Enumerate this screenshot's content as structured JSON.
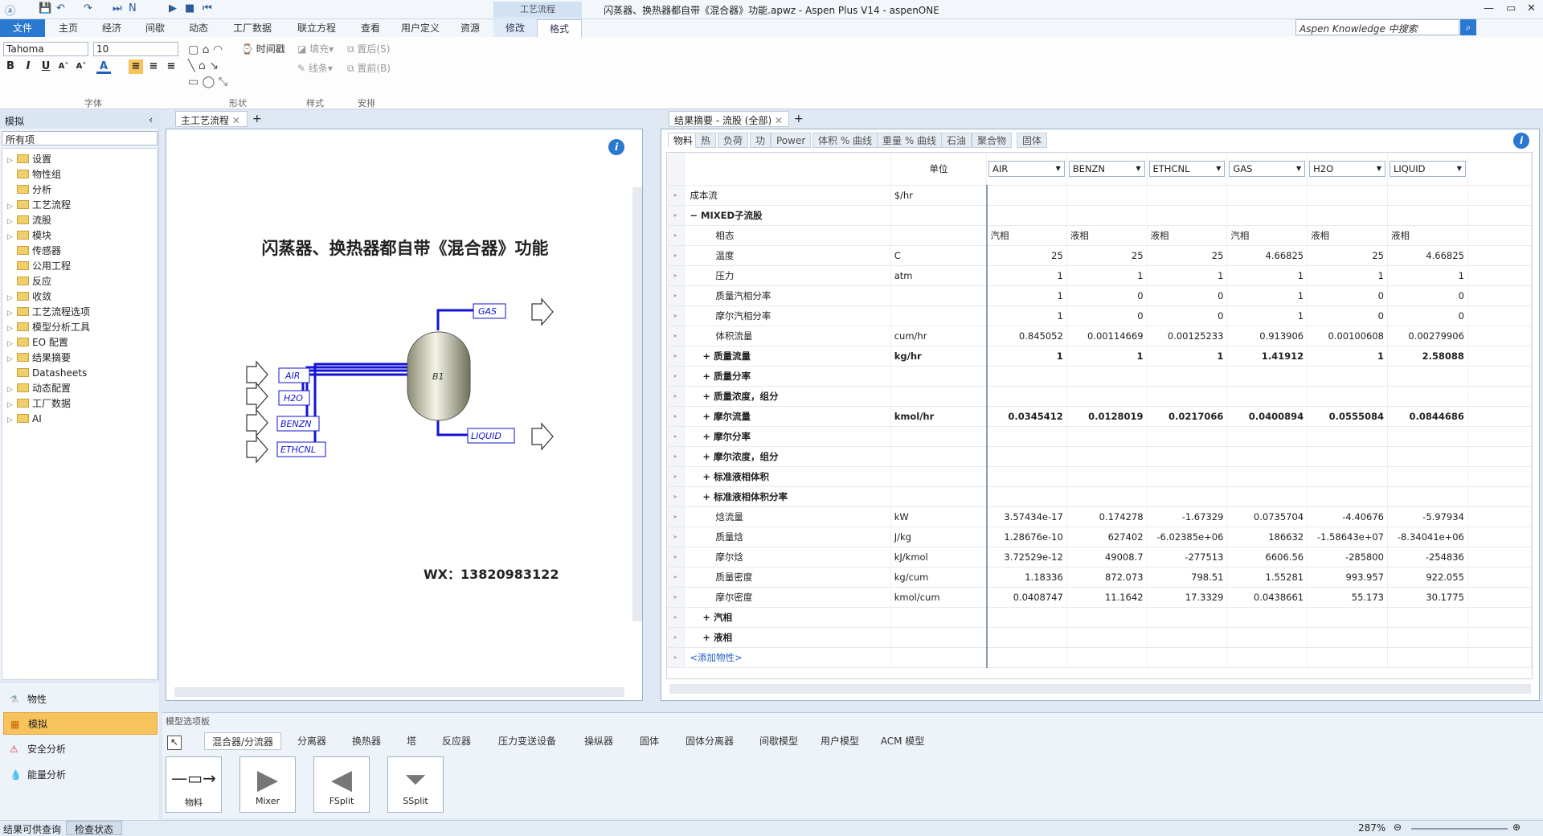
{
  "window": {
    "title": "闪蒸器、换热器都自带《混合器》功能.apwz - Aspen Plus V14 - aspenONE"
  },
  "ribbon": {
    "context_label": "工艺流程",
    "tabs": [
      "文件",
      "主页",
      "经济",
      "间歇",
      "动态",
      "工厂数据",
      "联立方程",
      "查看",
      "用户定义",
      "资源",
      "修改",
      "格式"
    ],
    "search_placeholder": "Aspen Knowledge 中搜索",
    "font_name": "Tahoma",
    "font_size": "10",
    "time_mark": "时间戳",
    "fill": "填充",
    "line": "线条",
    "to_back": "置后(S)",
    "to_front": "置前(B)",
    "groups": [
      "字体",
      "形状",
      "样式",
      "安排"
    ]
  },
  "nav": {
    "header": "模拟",
    "filter": "所有项",
    "tree": [
      "设置",
      "物性组",
      "分析",
      "工艺流程",
      "流股",
      "模块",
      "传感器",
      "公用工程",
      "反应",
      "收敛",
      "工艺流程选项",
      "模型分析工具",
      "EO 配置",
      "结果摘要",
      "Datasheets",
      "动态配置",
      "工厂数据",
      "AI"
    ],
    "buttons": [
      "物性",
      "模拟",
      "安全分析",
      "能量分析"
    ]
  },
  "flowsheet": {
    "tab": "主工艺流程",
    "title": "闪蒸器、换热器都自带《混合器》功能",
    "wx": "WX：13820983122",
    "streams": [
      "AIR",
      "H2O",
      "BENZN",
      "ETHCNL",
      "GAS",
      "LIQUID"
    ],
    "block": "B1"
  },
  "results": {
    "tab": "结果摘要 - 流股 (全部)",
    "subtabs": [
      "物料",
      "热",
      "负荷",
      "功",
      "Power",
      "体积 % 曲线",
      "重量 % 曲线",
      "石油",
      "聚合物",
      "固体"
    ],
    "unit_header": "单位",
    "columns": [
      "AIR",
      "BENZN",
      "ETHCNL",
      "GAS",
      "H2O",
      "LIQUID"
    ],
    "rows": [
      {
        "label": "成本流",
        "unit": "$/hr",
        "vals": [
          "",
          "",
          "",
          "",
          "",
          ""
        ]
      },
      {
        "label": "MIXED子流股",
        "unit": "",
        "vals": [
          "",
          "",
          "",
          "",
          "",
          ""
        ],
        "bold": true,
        "pre": "−"
      },
      {
        "label": "相态",
        "unit": "",
        "vals": [
          "汽相",
          "液相",
          "液相",
          "汽相",
          "液相",
          "液相"
        ],
        "indent": 2,
        "text": true
      },
      {
        "label": "温度",
        "unit": "C",
        "vals": [
          "25",
          "25",
          "25",
          "4.66825",
          "25",
          "4.66825"
        ],
        "indent": 2
      },
      {
        "label": "压力",
        "unit": "atm",
        "vals": [
          "1",
          "1",
          "1",
          "1",
          "1",
          "1"
        ],
        "indent": 2
      },
      {
        "label": "质量汽相分率",
        "unit": "",
        "vals": [
          "1",
          "0",
          "0",
          "1",
          "0",
          "0"
        ],
        "indent": 2
      },
      {
        "label": "摩尔汽相分率",
        "unit": "",
        "vals": [
          "1",
          "0",
          "0",
          "1",
          "0",
          "0"
        ],
        "indent": 2
      },
      {
        "label": "体积流量",
        "unit": "cum/hr",
        "vals": [
          "0.845052",
          "0.00114669",
          "0.00125233",
          "0.913906",
          "0.00100608",
          "0.00279906"
        ],
        "indent": 2
      },
      {
        "label": "质量流量",
        "unit": "kg/hr",
        "vals": [
          "1",
          "1",
          "1",
          "1.41912",
          "1",
          "2.58088"
        ],
        "bold": true,
        "pre": "+",
        "indent": 1
      },
      {
        "label": "质量分率",
        "unit": "",
        "vals": [
          "",
          "",
          "",
          "",
          "",
          ""
        ],
        "bold": true,
        "pre": "+",
        "indent": 1
      },
      {
        "label": "质量浓度，组分",
        "unit": "",
        "vals": [
          "",
          "",
          "",
          "",
          "",
          ""
        ],
        "bold": true,
        "pre": "+",
        "indent": 1
      },
      {
        "label": "摩尔流量",
        "unit": "kmol/hr",
        "vals": [
          "0.0345412",
          "0.0128019",
          "0.0217066",
          "0.0400894",
          "0.0555084",
          "0.0844686"
        ],
        "bold": true,
        "pre": "+",
        "indent": 1
      },
      {
        "label": "摩尔分率",
        "unit": "",
        "vals": [
          "",
          "",
          "",
          "",
          "",
          ""
        ],
        "bold": true,
        "pre": "+",
        "indent": 1
      },
      {
        "label": "摩尔浓度，组分",
        "unit": "",
        "vals": [
          "",
          "",
          "",
          "",
          "",
          ""
        ],
        "bold": true,
        "pre": "+",
        "indent": 1
      },
      {
        "label": "标准液相体积",
        "unit": "",
        "vals": [
          "",
          "",
          "",
          "",
          "",
          ""
        ],
        "bold": true,
        "pre": "+",
        "indent": 1
      },
      {
        "label": "标准液相体积分率",
        "unit": "",
        "vals": [
          "",
          "",
          "",
          "",
          "",
          ""
        ],
        "bold": true,
        "pre": "+",
        "indent": 1
      },
      {
        "label": "焓流量",
        "unit": "kW",
        "vals": [
          "3.57434e-17",
          "0.174278",
          "-1.67329",
          "0.0735704",
          "-4.40676",
          "-5.97934"
        ],
        "indent": 2
      },
      {
        "label": "质量焓",
        "unit": "J/kg",
        "vals": [
          "1.28676e-10",
          "627402",
          "-6.02385e+06",
          "186632",
          "-1.58643e+07",
          "-8.34041e+06"
        ],
        "indent": 2
      },
      {
        "label": "摩尔焓",
        "unit": "kJ/kmol",
        "vals": [
          "3.72529e-12",
          "49008.7",
          "-277513",
          "6606.56",
          "-285800",
          "-254836"
        ],
        "indent": 2
      },
      {
        "label": "质量密度",
        "unit": "kg/cum",
        "vals": [
          "1.18336",
          "872.073",
          "798.51",
          "1.55281",
          "993.957",
          "922.055"
        ],
        "indent": 2
      },
      {
        "label": "摩尔密度",
        "unit": "kmol/cum",
        "vals": [
          "0.0408747",
          "11.1642",
          "17.3329",
          "0.0438661",
          "55.173",
          "30.1775"
        ],
        "indent": 2
      },
      {
        "label": "汽相",
        "unit": "",
        "vals": [
          "",
          "",
          "",
          "",
          "",
          ""
        ],
        "bold": true,
        "pre": "+",
        "indent": 1
      },
      {
        "label": "液相",
        "unit": "",
        "vals": [
          "",
          "",
          "",
          "",
          "",
          ""
        ],
        "bold": true,
        "pre": "+",
        "indent": 1
      },
      {
        "label": "<添加物性>",
        "unit": "",
        "vals": [
          "",
          "",
          "",
          "",
          "",
          ""
        ],
        "link": true
      }
    ]
  },
  "palette": {
    "title": "模型选项板",
    "tabs": [
      "混合器/分流器",
      "分离器",
      "换热器",
      "塔",
      "反应器",
      "压力变送设备",
      "操纵器",
      "固体",
      "固体分离器",
      "间歇模型",
      "用户模型",
      "ACM 模型"
    ],
    "items": [
      "物料",
      "Mixer",
      "FSplit",
      "SSplit"
    ]
  },
  "status": {
    "left": "结果可供查询",
    "check": "检查状态",
    "zoom": "287%"
  }
}
